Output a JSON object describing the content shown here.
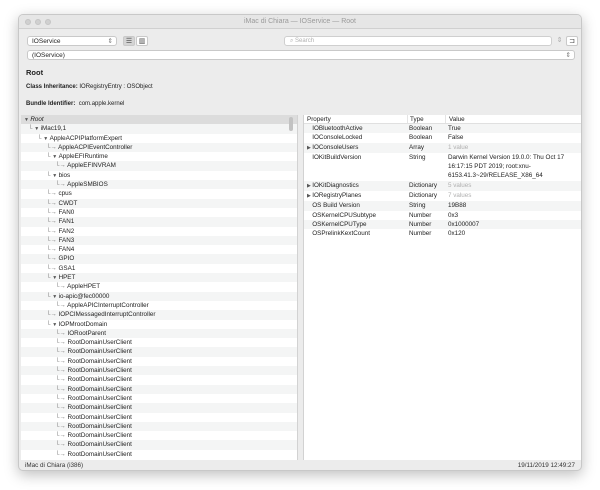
{
  "window": {
    "title": "iMac di Chiara — IOService — Root"
  },
  "toolbar": {
    "plane": "IOService",
    "search_placeholder": "Search",
    "path": "(IOService)"
  },
  "details": {
    "name": "Root",
    "class_label": "Class Inheritance:",
    "class_value": "IORegistryEntry : OSObject",
    "bundle_label": "Bundle Identifier:",
    "bundle_value": "com.apple.kernel"
  },
  "tree": [
    {
      "label": "Root",
      "depth": 0,
      "kind": "open"
    },
    {
      "label": "iMac19,1",
      "depth": 1,
      "kind": "open"
    },
    {
      "label": "AppleACPIPlatformExpert",
      "depth": 2,
      "kind": "open"
    },
    {
      "label": "AppleACPIEventController",
      "depth": 3,
      "kind": "leaf"
    },
    {
      "label": "AppleEFIRuntime",
      "depth": 3,
      "kind": "open"
    },
    {
      "label": "AppleEFINVRAM",
      "depth": 4,
      "kind": "leaf"
    },
    {
      "label": "bios",
      "depth": 3,
      "kind": "open"
    },
    {
      "label": "AppleSMBIOS",
      "depth": 4,
      "kind": "leaf"
    },
    {
      "label": "cpus",
      "depth": 3,
      "kind": "leaf"
    },
    {
      "label": "CWDT",
      "depth": 3,
      "kind": "leaf"
    },
    {
      "label": "FAN0",
      "depth": 3,
      "kind": "leaf"
    },
    {
      "label": "FAN1",
      "depth": 3,
      "kind": "leaf"
    },
    {
      "label": "FAN2",
      "depth": 3,
      "kind": "leaf"
    },
    {
      "label": "FAN3",
      "depth": 3,
      "kind": "leaf"
    },
    {
      "label": "FAN4",
      "depth": 3,
      "kind": "leaf"
    },
    {
      "label": "GPIO",
      "depth": 3,
      "kind": "leaf"
    },
    {
      "label": "GSA1",
      "depth": 3,
      "kind": "leaf"
    },
    {
      "label": "HPET",
      "depth": 3,
      "kind": "open"
    },
    {
      "label": "AppleHPET",
      "depth": 4,
      "kind": "leaf"
    },
    {
      "label": "io-apic@fec00000",
      "depth": 3,
      "kind": "open"
    },
    {
      "label": "AppleAPICInterruptController",
      "depth": 4,
      "kind": "leaf"
    },
    {
      "label": "IOPCIMessagedInterruptController",
      "depth": 3,
      "kind": "leaf"
    },
    {
      "label": "IOPMrootDomain",
      "depth": 3,
      "kind": "open"
    },
    {
      "label": "IORootParent",
      "depth": 4,
      "kind": "leaf"
    },
    {
      "label": "RootDomainUserClient",
      "depth": 4,
      "kind": "leaf"
    },
    {
      "label": "RootDomainUserClient",
      "depth": 4,
      "kind": "leaf"
    },
    {
      "label": "RootDomainUserClient",
      "depth": 4,
      "kind": "leaf"
    },
    {
      "label": "RootDomainUserClient",
      "depth": 4,
      "kind": "leaf"
    },
    {
      "label": "RootDomainUserClient",
      "depth": 4,
      "kind": "leaf"
    },
    {
      "label": "RootDomainUserClient",
      "depth": 4,
      "kind": "leaf"
    },
    {
      "label": "RootDomainUserClient",
      "depth": 4,
      "kind": "leaf"
    },
    {
      "label": "RootDomainUserClient",
      "depth": 4,
      "kind": "leaf"
    },
    {
      "label": "RootDomainUserClient",
      "depth": 4,
      "kind": "leaf"
    },
    {
      "label": "RootDomainUserClient",
      "depth": 4,
      "kind": "leaf"
    },
    {
      "label": "RootDomainUserClient",
      "depth": 4,
      "kind": "leaf"
    },
    {
      "label": "RootDomainUserClient",
      "depth": 4,
      "kind": "leaf"
    },
    {
      "label": "RootDomainUserClient",
      "depth": 4,
      "kind": "leaf"
    }
  ],
  "properties": {
    "headers": [
      "Property",
      "Type",
      "Value"
    ],
    "rows": [
      {
        "property": "IOBluetoothActive",
        "type": "Boolean",
        "value": "True",
        "expandable": false,
        "dim": false
      },
      {
        "property": "IOConsoleLocked",
        "type": "Boolean",
        "value": "False",
        "expandable": false,
        "dim": false
      },
      {
        "property": "IOConsoleUsers",
        "type": "Array",
        "value": "1 value",
        "expandable": true,
        "dim": true
      },
      {
        "property": "IOKitBuildVersion",
        "type": "String",
        "value": "Darwin Kernel Version 19.0.0: Thu Oct 17 16:17:15 PDT 2019; root:xnu-6153.41.3~29/RELEASE_X86_64",
        "expandable": false,
        "dim": false
      },
      {
        "property": "IOKitDiagnostics",
        "type": "Dictionary",
        "value": "5 values",
        "expandable": true,
        "dim": true
      },
      {
        "property": "IORegistryPlanes",
        "type": "Dictionary",
        "value": "7 values",
        "expandable": true,
        "dim": true
      },
      {
        "property": "OS Build Version",
        "type": "String",
        "value": "19B88",
        "expandable": false,
        "dim": false
      },
      {
        "property": "OSKernelCPUSubtype",
        "type": "Number",
        "value": "0x3",
        "expandable": false,
        "dim": false
      },
      {
        "property": "OSKernelCPUType",
        "type": "Number",
        "value": "0x1000007",
        "expandable": false,
        "dim": false
      },
      {
        "property": "OSPrelinkKextCount",
        "type": "Number",
        "value": "0x120",
        "expandable": false,
        "dim": false
      }
    ]
  },
  "status": {
    "left": "iMac di Chiara (i386)",
    "right": "19/11/2019 12:49:27"
  }
}
